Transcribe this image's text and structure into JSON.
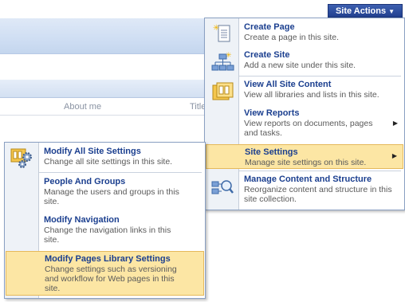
{
  "header": {
    "site_actions_label": "Site Actions"
  },
  "background": {
    "tabs": [
      "About me",
      "Title"
    ]
  },
  "site_actions_menu": {
    "items": [
      {
        "title": "Create Page",
        "desc": "Create a page in this site.",
        "icon": "page-icon"
      },
      {
        "title": "Create Site",
        "desc": "Add a new site under this site.",
        "icon": "site-hierarchy-icon"
      },
      {
        "title": "View All Site Content",
        "desc": "View all libraries and lists in this site.",
        "icon": "site-content-icon"
      },
      {
        "title": "View Reports",
        "desc": "View reports on documents, pages and tasks.",
        "icon": "reports-icon"
      },
      {
        "title": "Site Settings",
        "desc": "Manage site settings on this site.",
        "icon": "site-settings-icon"
      },
      {
        "title": "Manage Content and Structure",
        "desc": "Reorganize content and structure in this site collection.",
        "icon": "content-structure-icon"
      }
    ]
  },
  "site_settings_submenu": {
    "items": [
      {
        "title": "Modify All Site Settings",
        "desc": "Change all site settings in this site.",
        "icon": "settings-gears-icon"
      },
      {
        "title": "People And Groups",
        "desc": "Manage the users and groups in this site."
      },
      {
        "title": "Modify Navigation",
        "desc": "Change the navigation links in this site."
      },
      {
        "title": "Modify Pages Library Settings",
        "desc": "Change settings such as versioning and workflow for Web pages in this site."
      }
    ]
  }
}
